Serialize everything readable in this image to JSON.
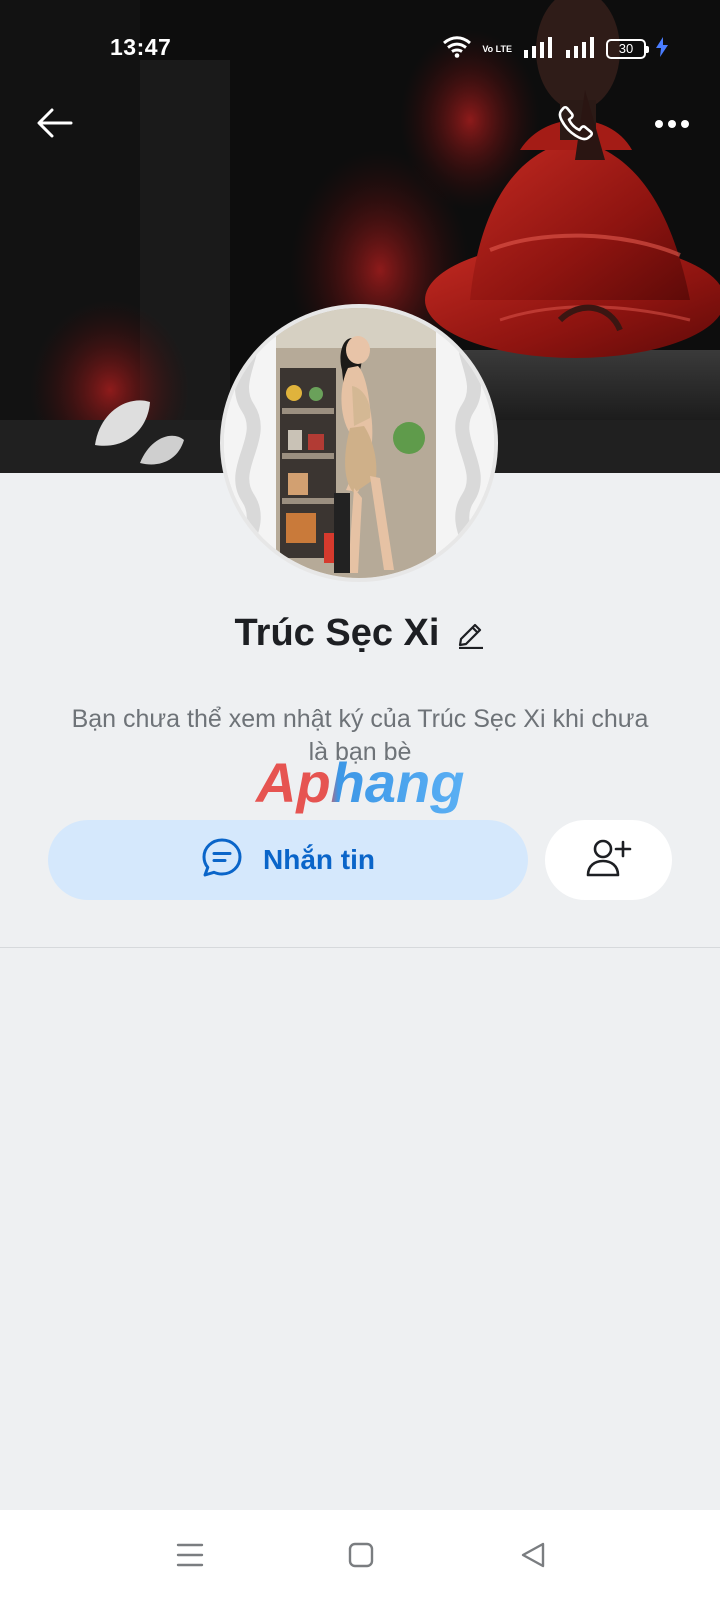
{
  "status_bar": {
    "time": "13:47",
    "network": "Vo LTE",
    "battery": "30"
  },
  "header": {
    "back_icon": "arrow-left-icon",
    "call_icon": "phone-icon",
    "more_icon": "more-horizontal-icon"
  },
  "profile": {
    "name": "Trúc Sẹc Xi",
    "edit_icon": "pencil-icon",
    "privacy_message": "Bạn chưa thể xem nhật ký của Trúc Sẹc Xi khi chưa là bạn bè"
  },
  "watermark": {
    "text": "Aphang",
    "colors": [
      "#e53935",
      "#1e88e5"
    ]
  },
  "actions": {
    "message_label": "Nhắn tin",
    "message_icon": "chat-bubble-icon",
    "add_friend_icon": "add-user-icon"
  },
  "nav": {
    "menu_icon": "menu-icon",
    "home_icon": "square-home-icon",
    "back_icon": "triangle-back-icon"
  },
  "colors": {
    "accent": "#0a65c9",
    "message_button_bg": "#d5e8fc",
    "page_bg": "#eef0f2"
  }
}
